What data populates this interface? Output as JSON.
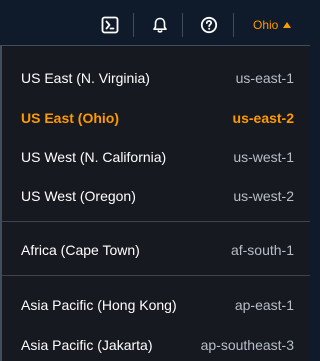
{
  "topbar": {
    "icons": [
      "cloudshell-icon",
      "bell-icon",
      "help-icon"
    ],
    "region_label": "Ohio",
    "accent_color": "#ff9900"
  },
  "regions": {
    "group1": [
      {
        "name": "US East (N. Virginia)",
        "code": "us-east-1",
        "selected": false
      },
      {
        "name": "US East (Ohio)",
        "code": "us-east-2",
        "selected": true
      },
      {
        "name": "US West (N. California)",
        "code": "us-west-1",
        "selected": false
      },
      {
        "name": "US West (Oregon)",
        "code": "us-west-2",
        "selected": false
      }
    ],
    "group2": [
      {
        "name": "Africa (Cape Town)",
        "code": "af-south-1",
        "selected": false
      }
    ],
    "group3": [
      {
        "name": "Asia Pacific (Hong Kong)",
        "code": "ap-east-1",
        "selected": false
      },
      {
        "name": "Asia Pacific (Jakarta)",
        "code": "ap-southeast-3",
        "selected": false
      }
    ]
  }
}
